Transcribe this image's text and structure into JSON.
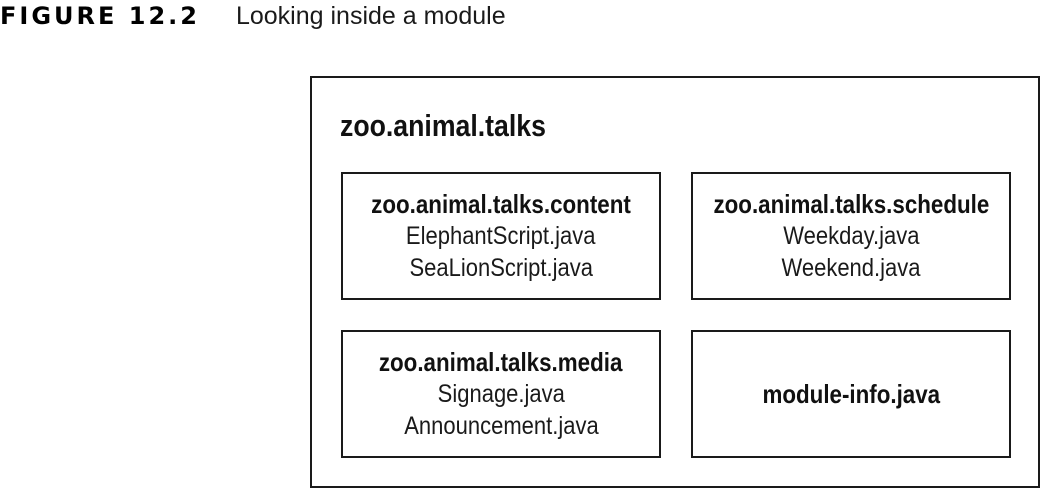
{
  "figure": {
    "label": "FIGURE 12.2",
    "title": "Looking inside a module"
  },
  "module": {
    "name": "zoo.animal.talks",
    "packages": [
      {
        "name": "zoo.animal.talks.content",
        "files": [
          "ElephantScript.java",
          "SeaLionScript.java"
        ]
      },
      {
        "name": "zoo.animal.talks.schedule",
        "files": [
          "Weekday.java",
          "Weekend.java"
        ]
      },
      {
        "name": "zoo.animal.talks.media",
        "files": [
          "Signage.java",
          "Announcement.java"
        ]
      }
    ],
    "module_info": "module-info.java"
  }
}
